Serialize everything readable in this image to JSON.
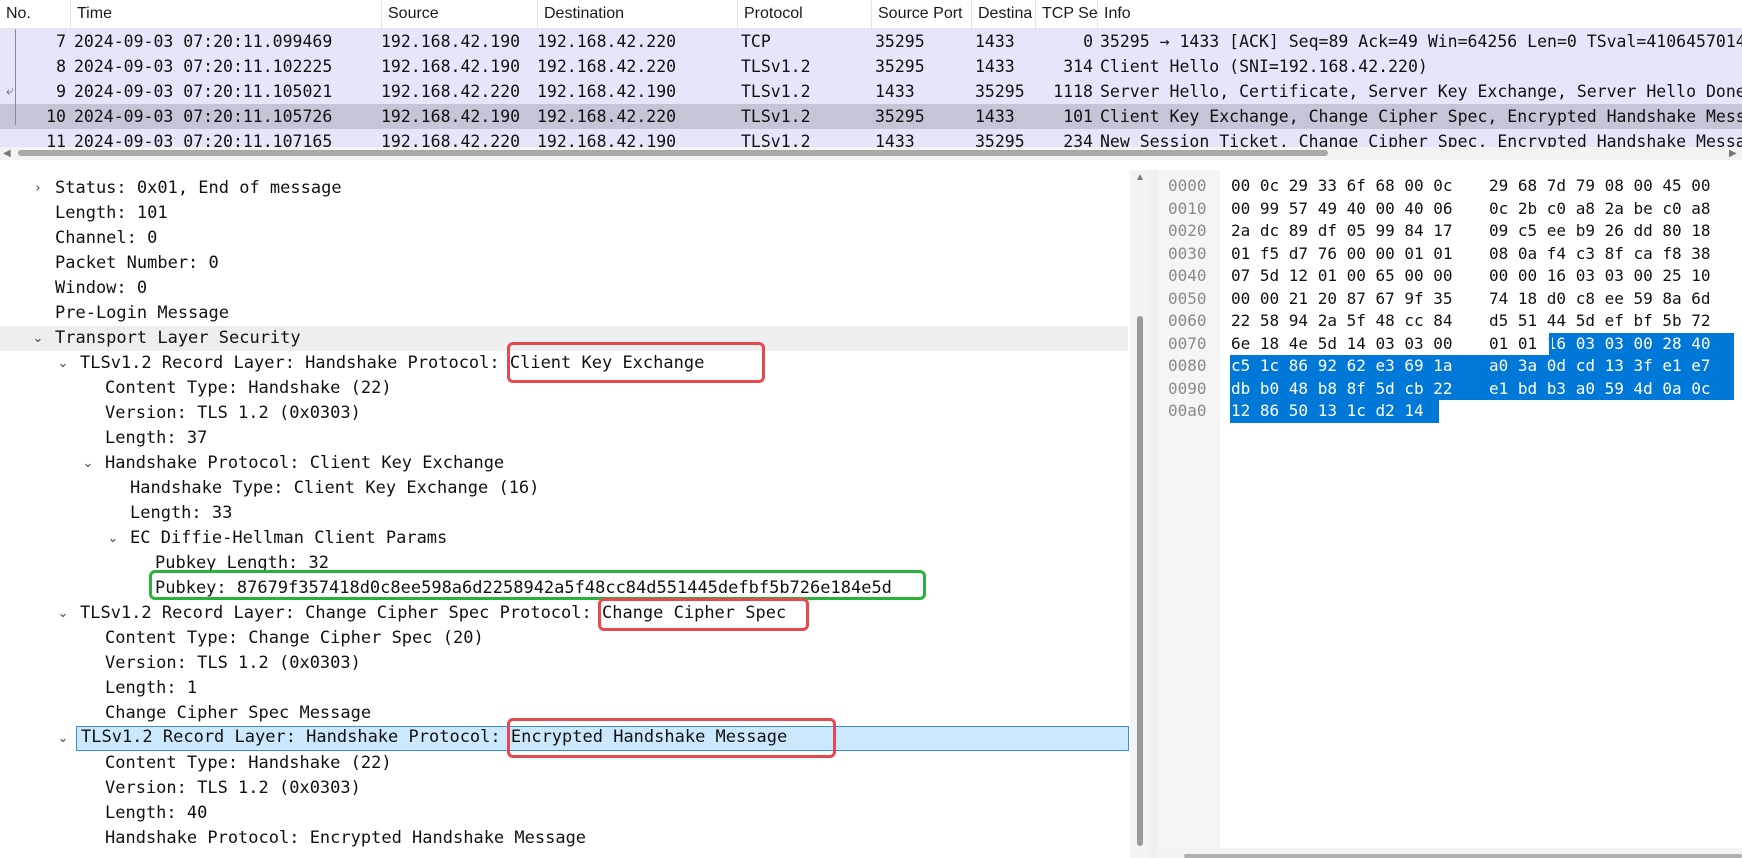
{
  "packet_list": {
    "columns": [
      "No.",
      "Time",
      "Source",
      "Destination",
      "Protocol",
      "Source Port",
      "Destina",
      "TCP Se",
      "Info"
    ],
    "rows": [
      {
        "no": "7",
        "time": "2024-09-03 07:20:11.099469",
        "source": "192.168.42.190",
        "destination": "192.168.42.220",
        "protocol": "TCP",
        "src_port": "35295",
        "dst_port": "1433",
        "tcp_seg": "0",
        "info": "35295 → 1433 [ACK] Seq=89 Ack=49 Win=64256 Len=0 TSval=4106457014"
      },
      {
        "no": "8",
        "time": "2024-09-03 07:20:11.102225",
        "source": "192.168.42.190",
        "destination": "192.168.42.220",
        "protocol": "TLSv1.2",
        "src_port": "35295",
        "dst_port": "1433",
        "tcp_seg": "314",
        "info": "Client Hello (SNI=192.168.42.220)"
      },
      {
        "no": "9",
        "time": "2024-09-03 07:20:11.105021",
        "source": "192.168.42.220",
        "destination": "192.168.42.190",
        "protocol": "TLSv1.2",
        "src_port": "1433",
        "dst_port": "35295",
        "tcp_seg": "1118",
        "info": "Server Hello, Certificate, Server Key Exchange, Server Hello Done"
      },
      {
        "no": "10",
        "time": "2024-09-03 07:20:11.105726",
        "source": "192.168.42.190",
        "destination": "192.168.42.220",
        "protocol": "TLSv1.2",
        "src_port": "35295",
        "dst_port": "1433",
        "tcp_seg": "101",
        "info": "Client Key Exchange, Change Cipher Spec, Encrypted Handshake Message"
      },
      {
        "no": "11",
        "time": "2024-09-03 07:20:11.107165",
        "source": "192.168.42.220",
        "destination": "192.168.42.190",
        "protocol": "TLSv1.2",
        "src_port": "1433",
        "dst_port": "35295",
        "tcp_seg": "234",
        "info": "New Session Ticket, Change Cipher Spec, Encrypted Handshake Message"
      }
    ],
    "selected_no": "10"
  },
  "details": {
    "rows": [
      {
        "label": "Status: 0x01, End of message",
        "toggle": "collapsed"
      },
      {
        "label": "Length: 101"
      },
      {
        "label": "Channel: 0"
      },
      {
        "label": "Packet Number: 0"
      },
      {
        "label": "Window: 0"
      },
      {
        "label": "Pre-Login Message"
      },
      {
        "label": "Transport Layer Security",
        "toggle": "expanded"
      },
      {
        "label": "TLSv1.2 Record Layer: Handshake Protocol: Client Key Exchange",
        "toggle": "expanded"
      },
      {
        "label": "Content Type: Handshake (22)"
      },
      {
        "label": "Version: TLS 1.2 (0x0303)"
      },
      {
        "label": "Length: 37"
      },
      {
        "label": "Handshake Protocol: Client Key Exchange",
        "toggle": "expanded"
      },
      {
        "label": "Handshake Type: Client Key Exchange (16)"
      },
      {
        "label": "Length: 33"
      },
      {
        "label": "EC Diffie-Hellman Client Params",
        "toggle": "expanded"
      },
      {
        "label": "Pubkey Length: 32"
      },
      {
        "label": "Pubkey: 87679f357418d0c8ee598a6d2258942a5f48cc84d551445defbf5b726e184e5d"
      },
      {
        "label": "TLSv1.2 Record Layer: Change Cipher Spec Protocol: Change Cipher Spec",
        "toggle": "expanded"
      },
      {
        "label": "Content Type: Change Cipher Spec (20)"
      },
      {
        "label": "Version: TLS 1.2 (0x0303)"
      },
      {
        "label": "Length: 1"
      },
      {
        "label": "Change Cipher Spec Message"
      },
      {
        "label": "TLSv1.2 Record Layer: Handshake Protocol: Encrypted Handshake Message",
        "toggle": "expanded",
        "selected": true
      },
      {
        "label": "Content Type: Handshake (22)"
      },
      {
        "label": "Version: TLS 1.2 (0x0303)"
      },
      {
        "label": "Length: 40"
      },
      {
        "label": "Handshake Protocol: Encrypted Handshake Message"
      }
    ]
  },
  "bytes": {
    "offsets": [
      "0000",
      "0010",
      "0020",
      "0030",
      "0040",
      "0050",
      "0060",
      "0070",
      "0080",
      "0090",
      "00a0"
    ],
    "lines": [
      [
        "00 0c 29 33 6f 68 00 0c",
        "29 68 7d 79 08 00 45 00"
      ],
      [
        "00 99 57 49 40 00 40 06",
        "0c 2b c0 a8 2a be c0 a8"
      ],
      [
        "2a dc 89 df 05 99 84 17",
        "09 c5 ee b9 26 dd 80 18"
      ],
      [
        "01 f5 d7 76 00 00 01 01",
        "08 0a f4 c3 8f ca f8 38"
      ],
      [
        "07 5d 12 01 00 65 00 00",
        "00 00 16 03 03 00 25 10"
      ],
      [
        "00 00 21 20 87 67 9f 35",
        "74 18 d0 c8 ee 59 8a 6d"
      ],
      [
        "22 58 94 2a 5f 48 cc 84",
        "d5 51 44 5d ef bf 5b 72"
      ],
      [
        "6e 18 4e 5d 14 03 03 00",
        "01 01 16 03 03 00 28 40"
      ],
      [
        "c5 1c 86 92 62 e3 69 1a",
        "a0 3a 0d cd 13 3f e1 e7"
      ],
      [
        "db b0 48 b8 8f 5d cb 22",
        "e1 bd b3 a0 59 4d 0a 0c"
      ],
      [
        "12 86 50 13 1c d2 14",
        ""
      ]
    ]
  },
  "colors": {
    "row_bg": "#e6e6fa",
    "row_selected": "#c5c5d8",
    "tree_selected": "#cce8ff",
    "highlight_red": "#e5484d",
    "highlight_green": "#29b23a",
    "bytes_selected": "#0078d7"
  }
}
